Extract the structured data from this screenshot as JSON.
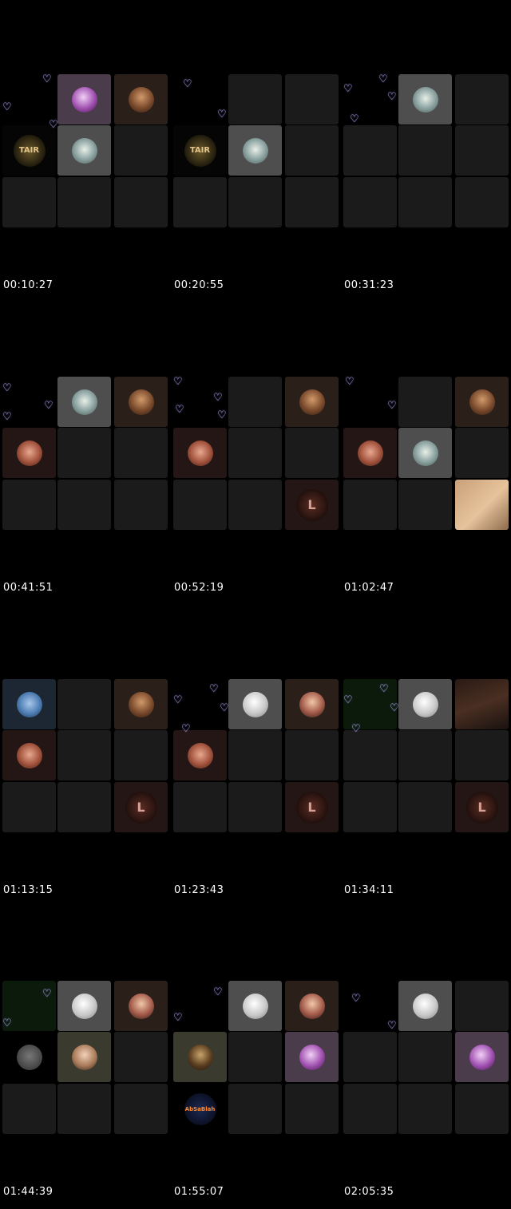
{
  "timestamps": [
    "00:10:27",
    "00:20:55",
    "00:31:23",
    "00:41:51",
    "00:52:19",
    "01:02:47",
    "01:13:15",
    "01:23:43",
    "01:34:11",
    "01:44:39",
    "01:55:07",
    "02:05:35"
  ],
  "logos": {
    "tair": "TAIR",
    "l": "L",
    "ab": "AbSaBlah"
  }
}
